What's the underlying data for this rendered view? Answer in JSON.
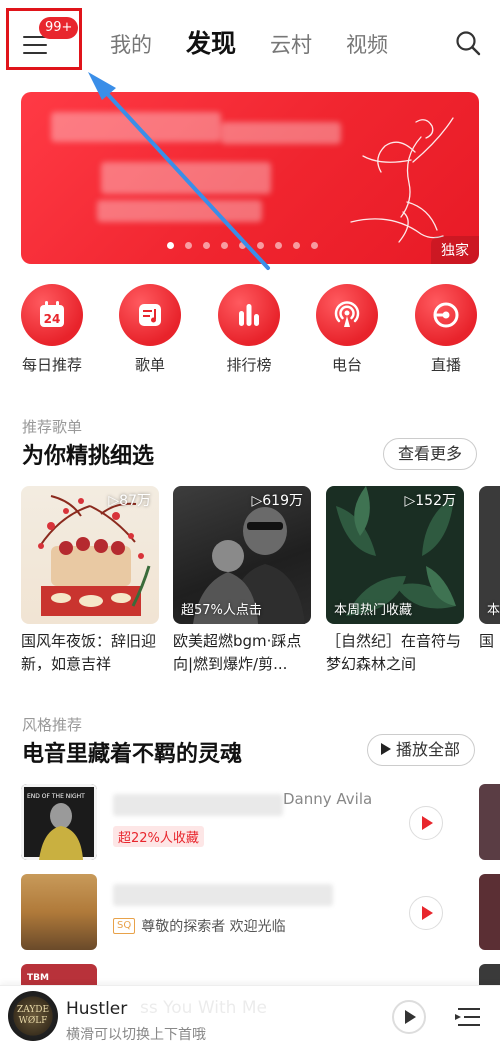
{
  "header": {
    "badge": "99+",
    "tabs": [
      "我的",
      "发现",
      "云村",
      "视频"
    ],
    "active_tab": "发现"
  },
  "banner": {
    "tag": "独家",
    "dot_count": 9,
    "active_dot": 0
  },
  "entries": [
    {
      "label": "每日推荐",
      "icon": "calendar-icon",
      "day": "24"
    },
    {
      "label": "歌单",
      "icon": "playlist-icon"
    },
    {
      "label": "排行榜",
      "icon": "chart-bars-icon"
    },
    {
      "label": "电台",
      "icon": "radio-icon"
    },
    {
      "label": "直播",
      "icon": "live-icon"
    }
  ],
  "recommend": {
    "subtitle": "推荐歌单",
    "title": "为你精挑细选",
    "more": "查看更多",
    "cards": [
      {
        "playcount": "▷87万",
        "tag": "",
        "title": "国风年夜饭：辞旧迎新，如意吉祥"
      },
      {
        "playcount": "▷619万",
        "tag": "超57%人点击",
        "title": "欧美超燃bgm·踩点向|燃到爆炸/剪..."
      },
      {
        "playcount": "▷152万",
        "tag": "本周热门收藏",
        "title": "［自然纪］在音符与梦幻森林之间"
      },
      {
        "playcount": "",
        "tag": "本",
        "title": "国"
      }
    ]
  },
  "style": {
    "subtitle": "风格推荐",
    "title": "电音里藏着不羁的灵魂",
    "play_all": "播放全部",
    "songs": [
      {
        "artist": "Danny Avila",
        "tag": "超22%人收藏",
        "cover_text": "END OF THE NIGHT"
      },
      {
        "artist": "",
        "quality": "SQ",
        "note": "尊敬的探索者 欢迎光临",
        "cover_text": ""
      },
      {
        "artist": "",
        "tag": "",
        "cover_text": "TBM"
      }
    ]
  },
  "player": {
    "title": "Hustler",
    "subtitle": "横滑可以切换上下首哦",
    "ghost": "ss You With Me",
    "disc_text": "ZAYDE WØLF"
  },
  "colors": {
    "accent": "#e8262d",
    "highlight_box": "#e0141a",
    "arrow": "#3a8ee8"
  }
}
